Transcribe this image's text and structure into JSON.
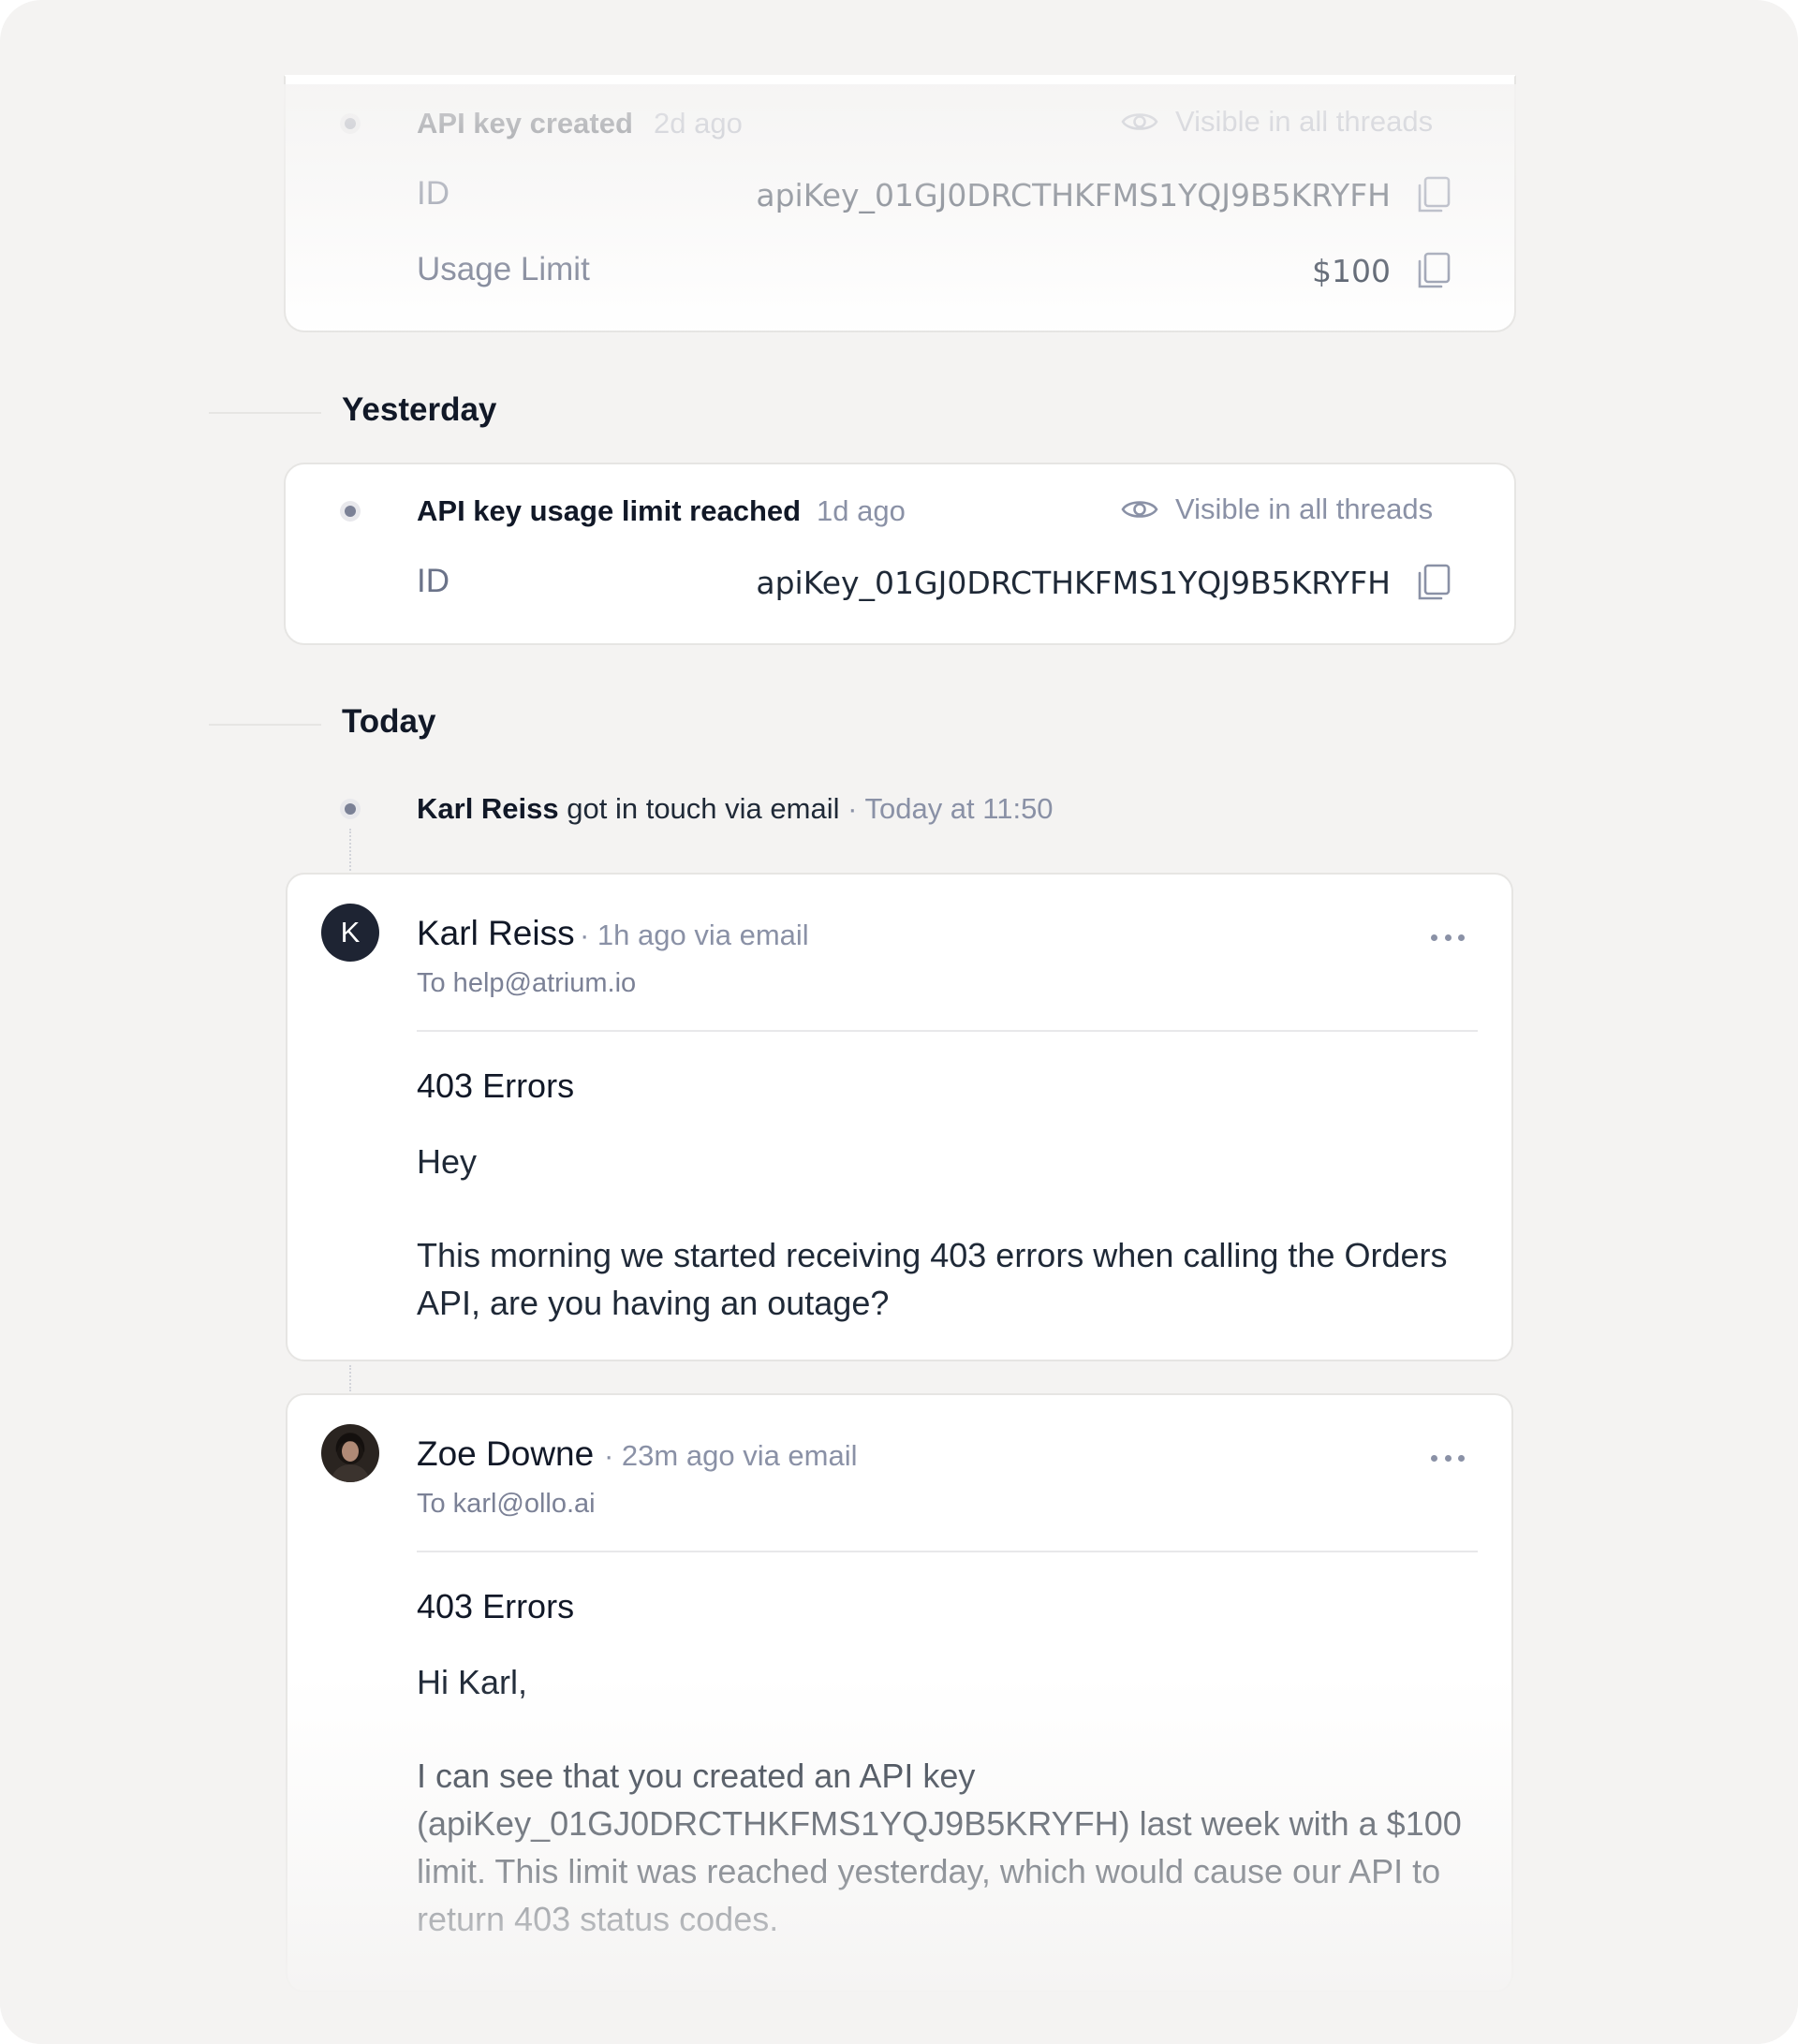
{
  "events": {
    "created": {
      "title": "API key created",
      "time": "2d ago",
      "visibility": "Visible in all threads",
      "rows": [
        {
          "label": "ID",
          "value": "apiKey_01GJ0DRCTHKFMS1YQJ9B5KRYFH"
        },
        {
          "label": "Usage Limit",
          "value": "$100"
        }
      ]
    },
    "limit_reached": {
      "title": "API key usage limit reached",
      "time": "1d ago",
      "visibility": "Visible in all threads",
      "rows": [
        {
          "label": "ID",
          "value": "apiKey_01GJ0DRCTHKFMS1YQJ9B5KRYFH"
        }
      ]
    }
  },
  "sections": {
    "yesterday": "Yesterday",
    "today": "Today"
  },
  "touch": {
    "name": "Karl Reiss",
    "text": " got in touch via email ",
    "sep": "·",
    "time": " Today at 11:50"
  },
  "messages": [
    {
      "initial": "K",
      "name": "Karl Reiss",
      "meta": "· 1h ago via email",
      "to": "To help@atrium.io",
      "subject": "403 Errors",
      "greeting": "Hey",
      "body": "This morning we started receiving 403 errors when calling the Orders API, are you having an outage?"
    },
    {
      "name": "Zoe Downe",
      "meta": "· 23m ago via email",
      "to": "To karl@ollo.ai",
      "subject": "403 Errors",
      "greeting": "Hi Karl,",
      "body": "I can see that you created an API key (apiKey_01GJ0DRCTHKFMS1YQJ9B5KRYFH) last week with a $100 limit. This limit was reached yesterday, which would cause our API to return 403 status codes."
    }
  ],
  "icons": {
    "visibility": "eye-icon",
    "copy": "copy-icon",
    "more": "more-horizontal-icon"
  },
  "colors": {
    "background": "#f4f3f2",
    "card": "#ffffff",
    "muted_text": "#8a91a6",
    "dot": "#7b8196",
    "avatar": "#1e2433"
  }
}
